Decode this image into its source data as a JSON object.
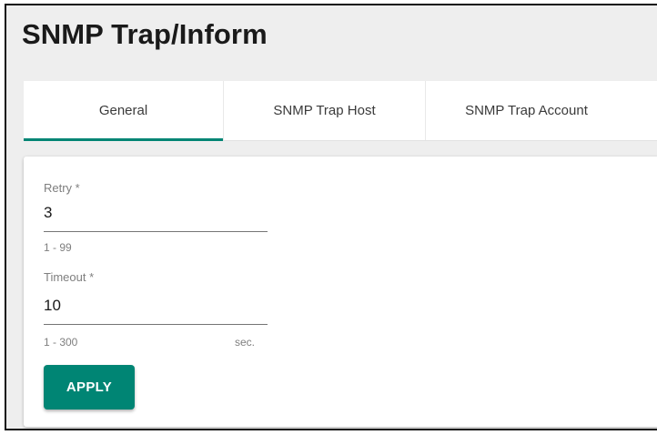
{
  "page": {
    "title": "SNMP Trap/Inform"
  },
  "tabs": [
    {
      "label": "General",
      "active": true
    },
    {
      "label": "SNMP Trap Host",
      "active": false
    },
    {
      "label": "SNMP Trap Account",
      "active": false
    }
  ],
  "form": {
    "retry": {
      "label": "Retry *",
      "value": "3",
      "hint": "1 - 99"
    },
    "timeout": {
      "label": "Timeout *",
      "value": "10",
      "hint": "1 - 300",
      "unit": "sec."
    },
    "apply_label": "APPLY"
  },
  "colors": {
    "accent": "#008574",
    "background": "#eeeeee",
    "panel": "#ffffff"
  }
}
